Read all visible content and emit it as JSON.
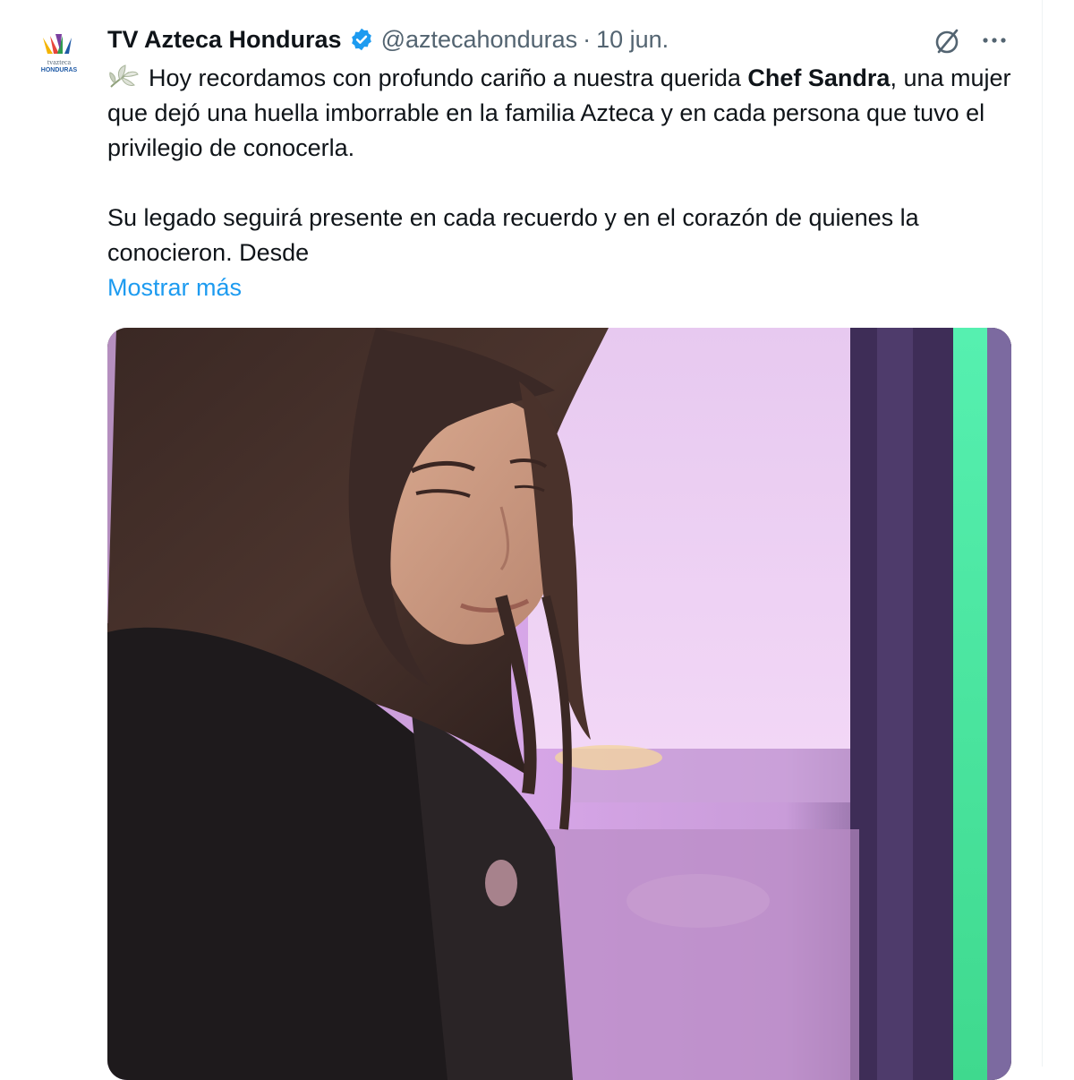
{
  "tweet": {
    "author_name": "TV Azteca Honduras",
    "handle": "@aztecahonduras",
    "separator": "·",
    "date": "10 jun.",
    "avatar_logo_line1": "tvazteca",
    "avatar_logo_line2": "HONDURAS",
    "text_line1_before": "Hoy recordamos con profundo cariño a nuestra querida ",
    "text_line1_bold": "Chef Sandra",
    "text_line1_after": ", una mujer que dejó una huella imborrable en la familia Azteca y en cada persona que tuvo el privilegio de conocerla.",
    "text_paragraph2": "Su legado seguirá presente en cada recuerdo y en el corazón de quienes la conocieron. Desde",
    "show_more": "Mostrar más"
  },
  "icons": {
    "verified": "verified-badge-icon",
    "grok": "grok-icon",
    "more": "more-options-icon",
    "leaf": "white-lily-icon"
  },
  "colors": {
    "text": "#0f1419",
    "secondary": "#536471",
    "link": "#1d9bf0",
    "verified": "#1d9bf0"
  }
}
